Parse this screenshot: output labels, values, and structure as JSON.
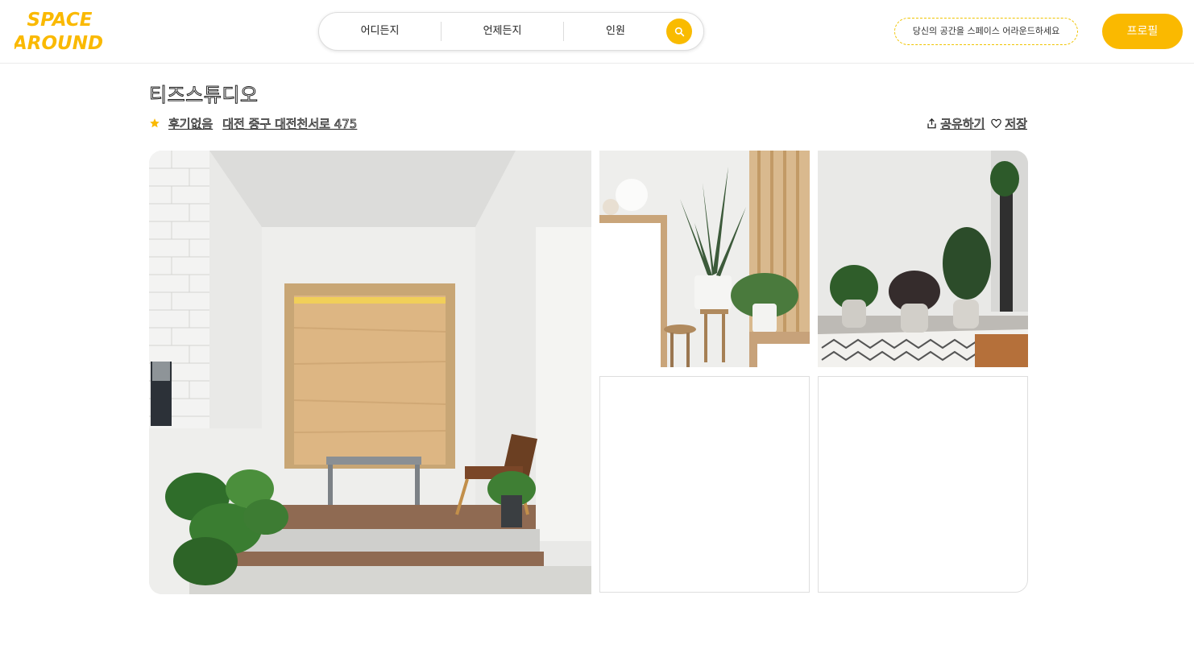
{
  "brand": {
    "line1": "SPACE",
    "line2": "AROUND",
    "color": "#fab900"
  },
  "search": {
    "where": "어디든지",
    "when": "언제든지",
    "guests": "인원",
    "button_icon": "search-icon",
    "accent": "#f9bb00"
  },
  "header": {
    "host_cta": "당신의 공간을 스페이스 어라운드하세요",
    "profile": "프로필"
  },
  "listing": {
    "title": "티즈스튜디오",
    "rating_icon": "star-icon",
    "review_text": "후기없음",
    "address": "대전 중구 대전천서로 475",
    "share": "공유하기",
    "save": "저장"
  },
  "gallery": {
    "photos": [
      {
        "name": "main-photo",
        "alt": "studio-alcove"
      },
      {
        "name": "photo-plants-1",
        "alt": "snake-plant"
      },
      {
        "name": "photo-plants-2",
        "alt": "potted-plants"
      },
      {
        "name": "photo-empty-1",
        "alt": ""
      },
      {
        "name": "photo-empty-2",
        "alt": ""
      }
    ]
  }
}
